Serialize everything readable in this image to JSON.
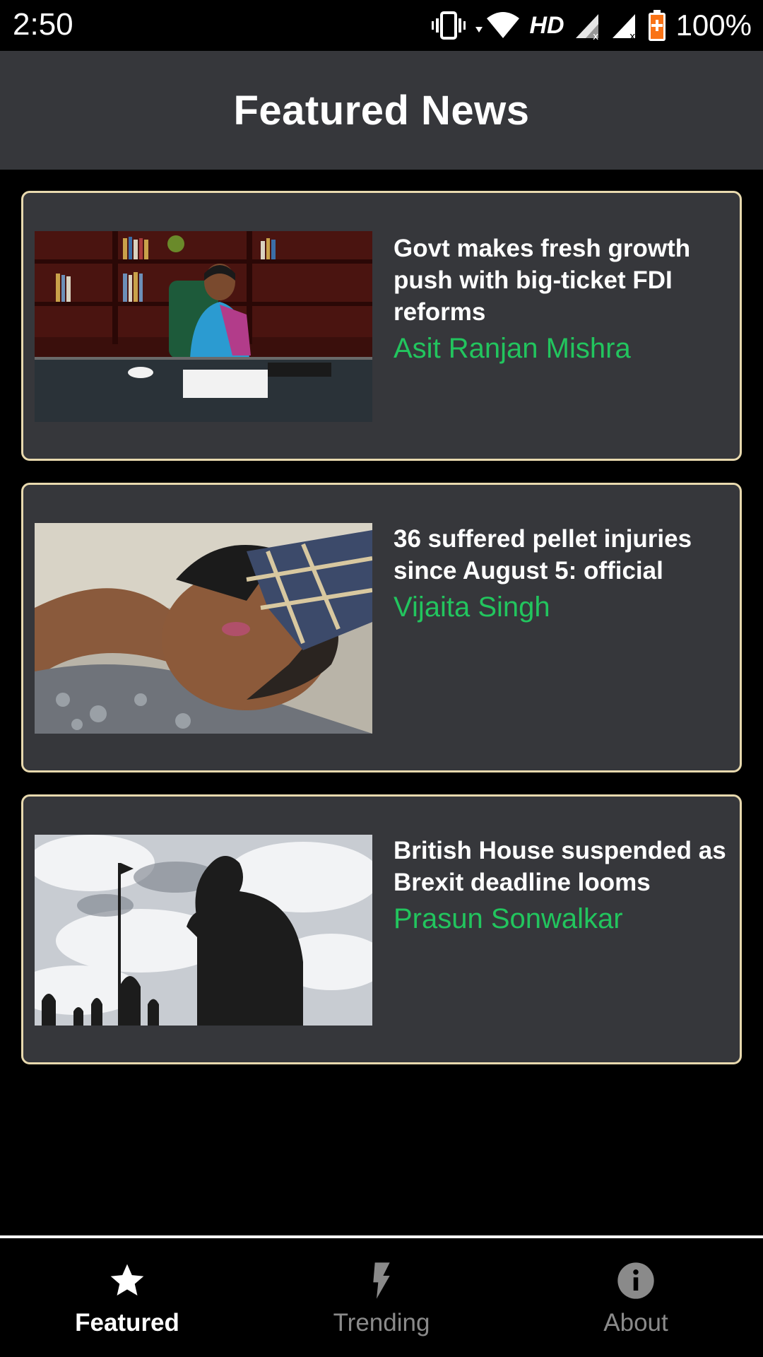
{
  "status_bar": {
    "time": "2:50",
    "network_label": "HD",
    "battery": "100%",
    "icons": [
      "vibrate-icon",
      "wifi-icon",
      "signal-icon",
      "signal-icon",
      "battery-charging-icon"
    ]
  },
  "app_bar": {
    "title": "Featured News"
  },
  "articles": [
    {
      "headline": "Govt makes fresh growth push with big-ticket FDI reforms",
      "author": "Asit Ranjan Mishra"
    },
    {
      "headline": "36 suffered pellet injuries since August 5: official",
      "author": "Vijaita Singh"
    },
    {
      "headline": "British House suspended as Brexit deadline looms",
      "author": "Prasun Sonwalkar"
    }
  ],
  "bottom_nav": {
    "items": [
      {
        "label": "Featured",
        "icon": "star-icon",
        "active": true
      },
      {
        "label": "Trending",
        "icon": "bolt-icon",
        "active": false
      },
      {
        "label": "About",
        "icon": "info-icon",
        "active": false
      }
    ]
  },
  "colors": {
    "card_background": "#36373b",
    "card_border": "#e8d9ae",
    "author_text": "#22c55e",
    "app_bar": "#36373b"
  }
}
